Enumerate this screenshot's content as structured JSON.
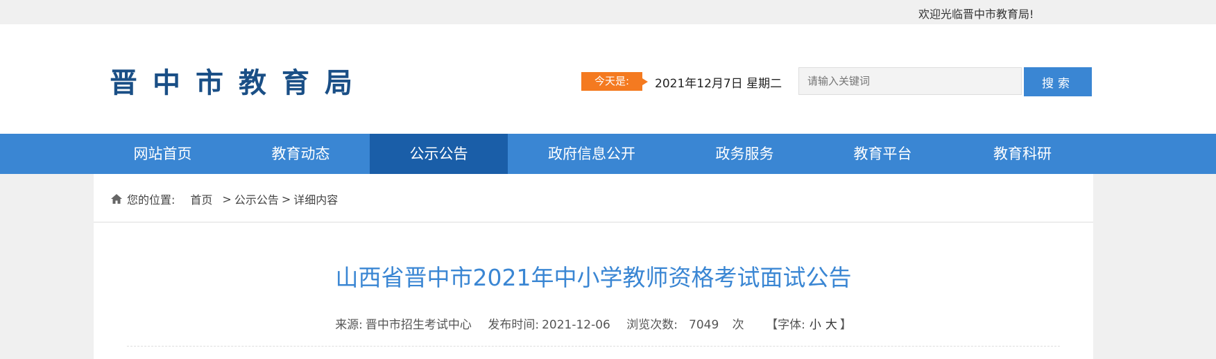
{
  "topbar": {
    "welcome": "欢迎光临晋中市教育局!"
  },
  "header": {
    "logo": "晋中市教育局",
    "today_label": "今天是:",
    "today_date": "2021年12月7日 星期二",
    "search_placeholder": "请输入关键词",
    "search_button": "搜索"
  },
  "nav": {
    "items": [
      {
        "label": "网站首页"
      },
      {
        "label": "教育动态"
      },
      {
        "label": "公示公告"
      },
      {
        "label": "政府信息公开"
      },
      {
        "label": "政务服务"
      },
      {
        "label": "教育平台"
      },
      {
        "label": "教育科研"
      }
    ],
    "active_index": 2
  },
  "breadcrumb": {
    "label": "您的位置:",
    "items": [
      "首页",
      "公示公告",
      "详细内容"
    ],
    "separator": ">"
  },
  "article": {
    "title": "山西省晋中市2021年中小学教师资格考试面试公告",
    "source_label": "来源:",
    "source": "晋中市招生考试中心",
    "publish_label": "发布时间:",
    "publish_date": "2021-12-06",
    "views_label": "浏览次数:",
    "views": "7049",
    "views_unit": "次",
    "font_label": "【字体:",
    "font_small": "小",
    "font_large": "大",
    "font_close": "】"
  },
  "colors": {
    "primary": "#3a86d3",
    "active_nav": "#1a5ea8",
    "accent": "#f47a20",
    "logo": "#1a4f86"
  },
  "icons": {
    "breadcrumb": "home-icon"
  }
}
